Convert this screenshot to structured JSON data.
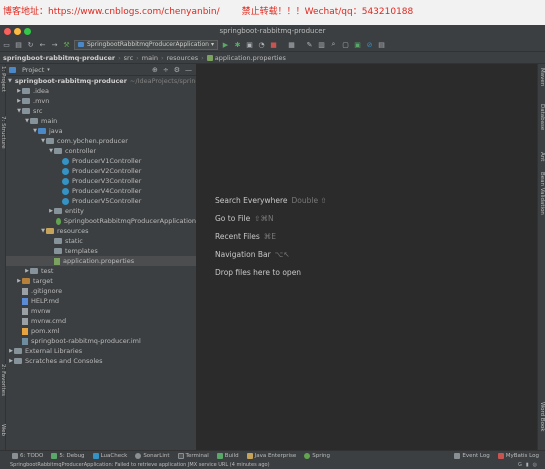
{
  "banner": {
    "blog": "博客地址：https://www.cnblogs.com/chenyanbin/",
    "notice": "禁止转载！！！Wechat/qq：543210188"
  },
  "window": {
    "title": "springboot-rabbitmq-producer"
  },
  "toolbar": {
    "run_config": "SpringbootRabbitmqProducerApplication"
  },
  "breadcrumb": [
    "springboot-rabbitmq-producer",
    "src",
    "main",
    "resources",
    "application.properties"
  ],
  "left_strip": [
    "1: Project",
    "7: Structure",
    "2: Favorites",
    "Web"
  ],
  "right_strip": [
    "Maven",
    "Database",
    "Ant",
    "Bean Validation",
    "Word Book"
  ],
  "project_panel": {
    "header": "Project",
    "tree": [
      {
        "label": "springboot-rabbitmq-producer",
        "extra": "~/IdeaProjects/springboot"
      },
      {
        "label": ".idea"
      },
      {
        "label": ".mvn"
      },
      {
        "label": "src"
      },
      {
        "label": "main"
      },
      {
        "label": "java"
      },
      {
        "label": "com.ybchen.producer"
      },
      {
        "label": "controller"
      },
      {
        "label": "ProducerV1Controller"
      },
      {
        "label": "ProducerV2Controller"
      },
      {
        "label": "ProducerV3Controller"
      },
      {
        "label": "ProducerV4Controller"
      },
      {
        "label": "ProducerV5Controller"
      },
      {
        "label": "entity"
      },
      {
        "label": "SpringbootRabbitmqProducerApplication"
      },
      {
        "label": "resources"
      },
      {
        "label": "static"
      },
      {
        "label": "templates"
      },
      {
        "label": "application.properties"
      },
      {
        "label": "test"
      },
      {
        "label": "target"
      },
      {
        "label": ".gitignore"
      },
      {
        "label": "HELP.md"
      },
      {
        "label": "mvnw"
      },
      {
        "label": "mvnw.cmd"
      },
      {
        "label": "pom.xml"
      },
      {
        "label": "springboot-rabbitmq-producer.iml"
      },
      {
        "label": "External Libraries"
      },
      {
        "label": "Scratches and Consoles"
      }
    ]
  },
  "editor_hints": [
    {
      "label": "Search Everywhere",
      "key": "Double ⇧"
    },
    {
      "label": "Go to File",
      "key": "⇧⌘N"
    },
    {
      "label": "Recent Files",
      "key": "⌘E"
    },
    {
      "label": "Navigation Bar",
      "key": "⌥↖"
    },
    {
      "label": "Drop files here to open",
      "key": ""
    }
  ],
  "bottom_tools": {
    "left": [
      "6: TODO",
      "5: Debug",
      "LuaCheck",
      "SonarLint",
      "Terminal",
      "Build",
      "Java Enterprise",
      "Spring"
    ],
    "right": [
      "Event Log",
      "MyBatis Log"
    ]
  },
  "status": {
    "message": "SpringbootRabbitmqProducerApplication: Failed to retrieve application JMX service URL (4 minutes ago)"
  },
  "colors": {
    "accent": "#4a88c7",
    "banner_text": "#e0281e",
    "panel_bg": "#3c3f41",
    "editor_bg": "#2b2b2b"
  }
}
